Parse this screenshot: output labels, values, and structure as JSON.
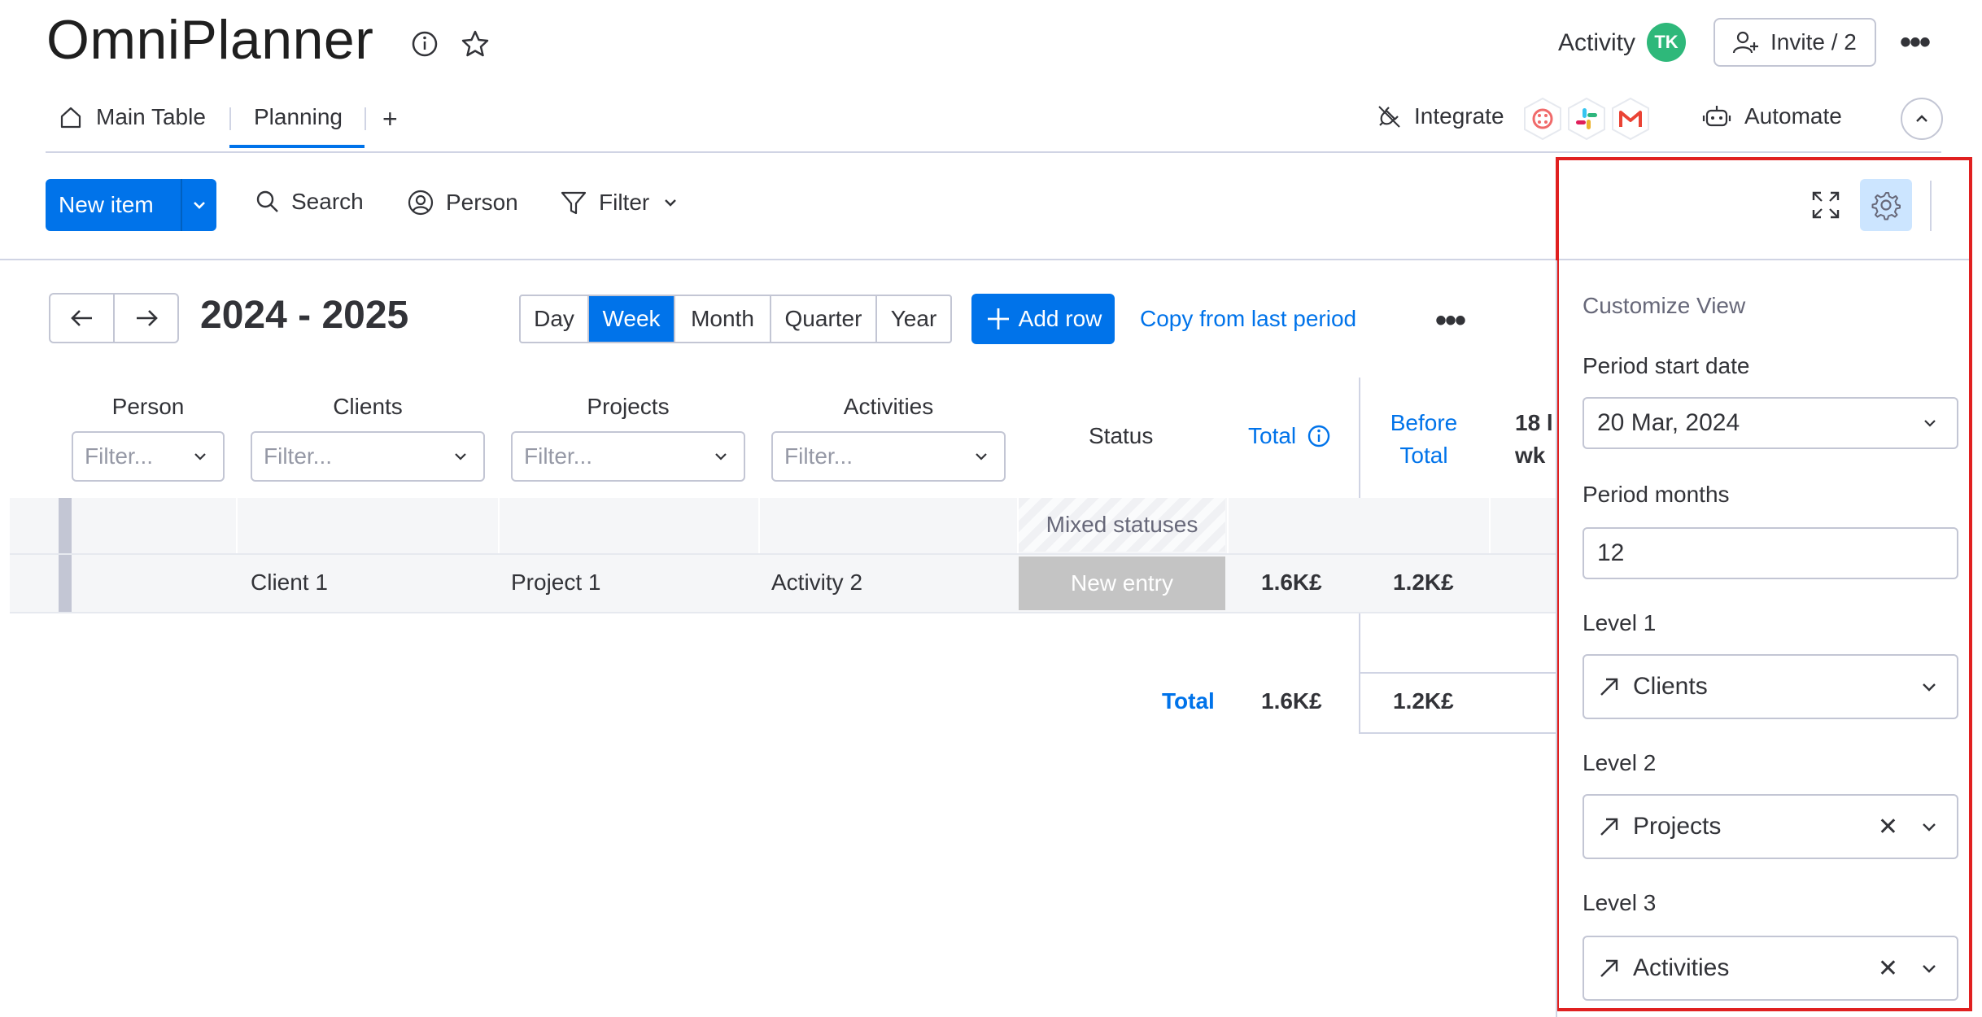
{
  "header": {
    "title": "OmniPlanner",
    "activity_label": "Activity",
    "avatar_initials": "TK",
    "invite_label": "Invite / 2"
  },
  "tabs": [
    {
      "label": "Main Table",
      "icon": "home-icon"
    },
    {
      "label": "Planning"
    },
    {
      "label": "+"
    }
  ],
  "integrations": {
    "integrate_label": "Integrate",
    "automate_label": "Automate",
    "apps": [
      "twilio-icon",
      "slack-icon",
      "gmail-icon"
    ]
  },
  "toolbar": {
    "new_item_label": "New item",
    "search_label": "Search",
    "person_label": "Person",
    "filter_label": "Filter"
  },
  "planner": {
    "period_label": "2024 - 2025",
    "scale_options": [
      "Day",
      "Week",
      "Month",
      "Quarter",
      "Year"
    ],
    "scale_selected": "Week",
    "add_row_label": "Add row",
    "copy_label": "Copy from last period"
  },
  "table": {
    "columns": {
      "person": "Person",
      "clients": "Clients",
      "projects": "Projects",
      "activities": "Activities",
      "status": "Status",
      "total": "Total",
      "before_total_line1": "Before",
      "before_total_line2": "Total",
      "week_line1": "18 l",
      "week_line2": "wk"
    },
    "filter_placeholder": "Filter...",
    "group_row": {
      "status": "Mixed statuses"
    },
    "rows": [
      {
        "person": "",
        "client": "Client 1",
        "project": "Project 1",
        "activity": "Activity 2",
        "status": "New entry",
        "total": "1.6K£",
        "before_total": "1.2K£"
      }
    ],
    "footer": {
      "label": "Total",
      "total": "1.6K£",
      "before_total": "1.2K£"
    }
  },
  "customize_panel": {
    "title": "Customize View",
    "period_start_label": "Period start date",
    "period_start_value": "20 Mar, 2024",
    "period_months_label": "Period months",
    "period_months_value": "12",
    "level1_label": "Level 1",
    "level1_value": "Clients",
    "level2_label": "Level 2",
    "level2_value": "Projects",
    "level3_label": "Level 3",
    "level3_value": "Activities"
  },
  "colors": {
    "accent": "#0073ea",
    "highlight_border": "#e02020",
    "avatar": "#2eb87a"
  }
}
